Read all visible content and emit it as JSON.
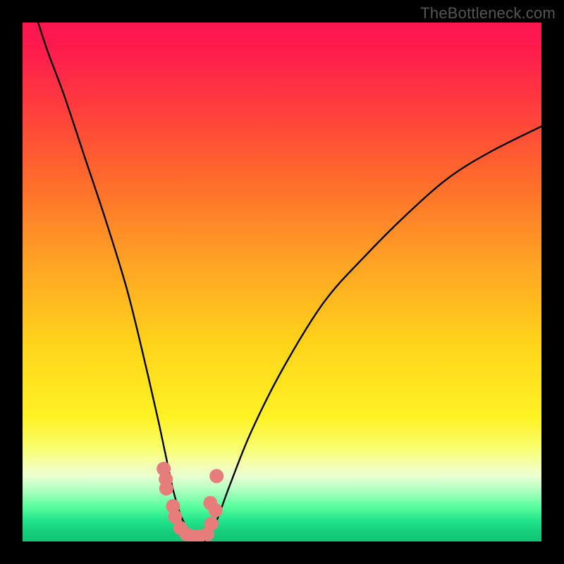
{
  "watermark": "TheBottleneck.com",
  "chart_data": {
    "type": "line",
    "title": "",
    "xlabel": "",
    "ylabel": "",
    "xlim": [
      0,
      100
    ],
    "ylim": [
      0,
      100
    ],
    "series": [
      {
        "name": "bottleneck-curve",
        "x": [
          3,
          5,
          8,
          12,
          16,
          20,
          23,
          26,
          27.5,
          29,
          30.5,
          32,
          33.5,
          35,
          37,
          40,
          44,
          50,
          58,
          66,
          74,
          82,
          90,
          100
        ],
        "values": [
          100,
          94,
          86,
          74,
          62,
          49,
          37,
          24,
          17,
          10,
          5,
          2,
          0,
          0,
          3,
          11,
          21,
          33,
          46,
          55,
          63,
          70,
          75,
          80
        ]
      },
      {
        "name": "bottom-dots",
        "x": [
          27.2,
          27.6,
          27.7,
          29.0,
          29.4,
          30.4,
          31.6,
          32.6,
          34.0,
          35.6,
          36.2,
          36.4,
          37.2,
          37.4
        ],
        "values": [
          14.0,
          12.0,
          10.2,
          6.8,
          4.8,
          2.6,
          1.4,
          1.0,
          1.0,
          1.4,
          7.4,
          3.4,
          6.0,
          12.6
        ]
      }
    ],
    "dot_color": "#e77d7a",
    "curve_color": "#000000",
    "gradient_stops": [
      {
        "pos": 0,
        "color": "#ff1450"
      },
      {
        "pos": 0.3,
        "color": "#ff6a2c"
      },
      {
        "pos": 0.62,
        "color": "#ffd41a"
      },
      {
        "pos": 0.82,
        "color": "#f8fe6e"
      },
      {
        "pos": 0.9,
        "color": "#b2ffc2"
      },
      {
        "pos": 1.0,
        "color": "#10c674"
      }
    ]
  }
}
